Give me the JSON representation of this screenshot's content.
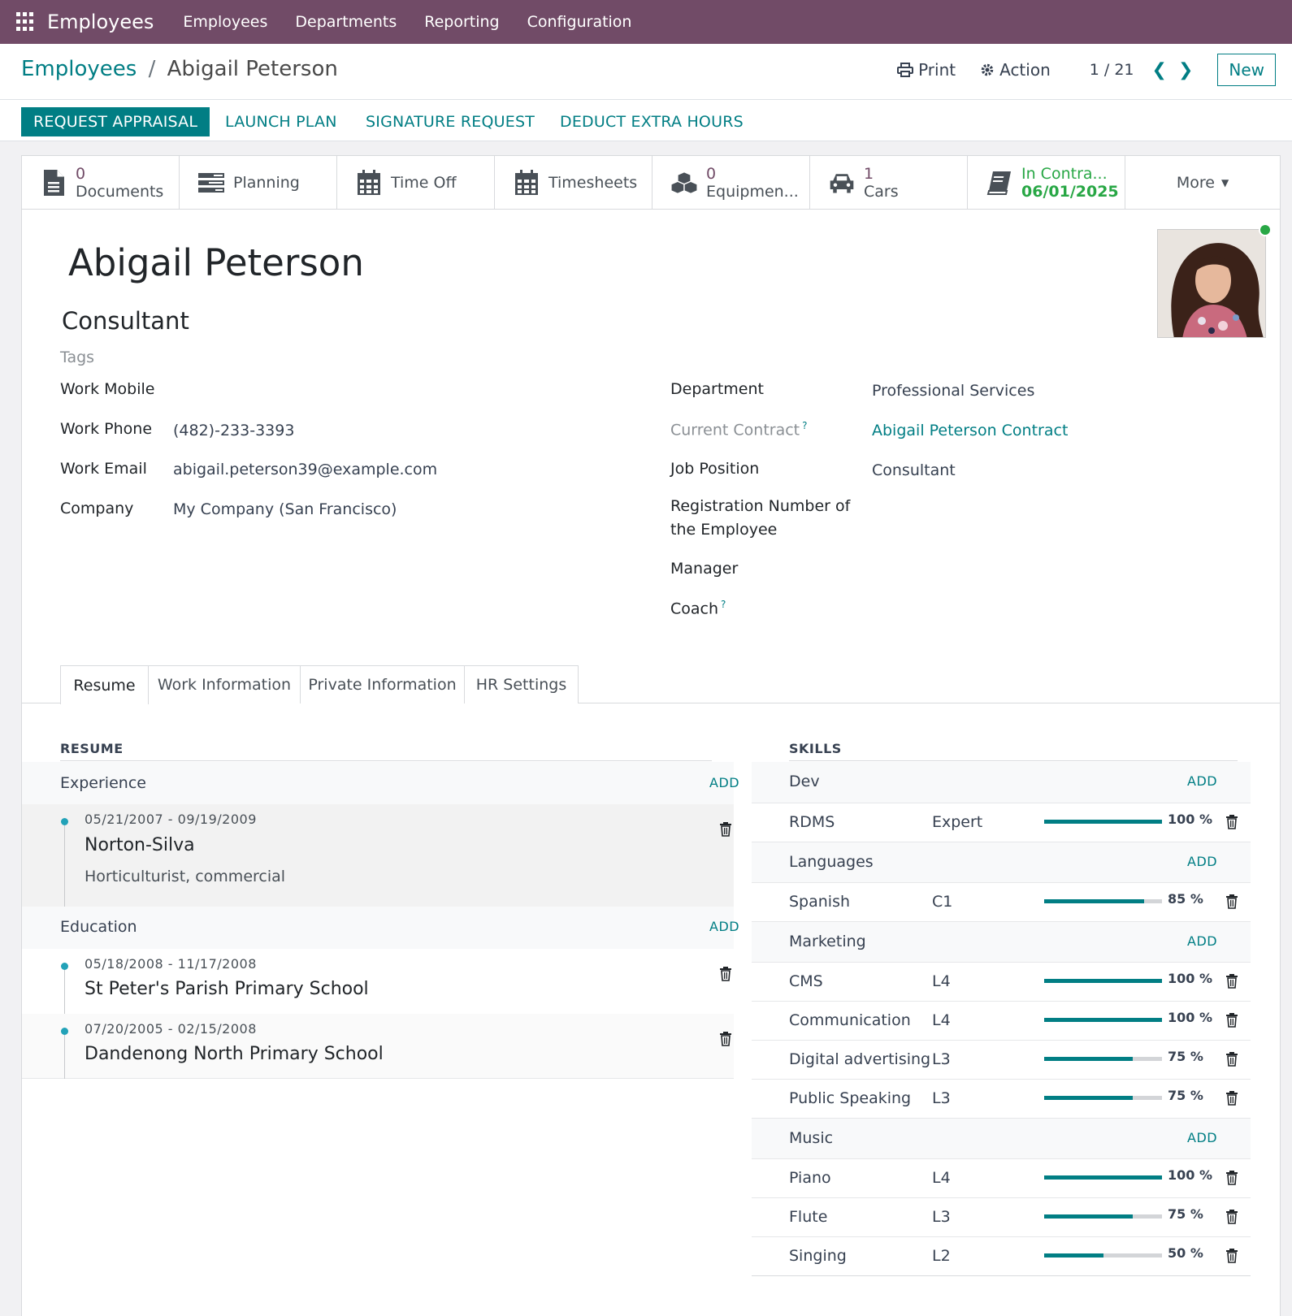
{
  "topnav": {
    "app_title": "Employees",
    "menu": [
      "Employees",
      "Departments",
      "Reporting",
      "Configuration"
    ]
  },
  "breadcrumb": {
    "parent": "Employees",
    "separator": "/",
    "current": "Abigail Peterson"
  },
  "control": {
    "print": "Print",
    "action": "Action",
    "pager": "1 / 21",
    "new": "New"
  },
  "statusbar": {
    "buttons": [
      "REQUEST APPRAISAL",
      "LAUNCH PLAN",
      "SIGNATURE REQUEST",
      "DEDUCT EXTRA HOURS"
    ]
  },
  "smart_buttons": {
    "documents": {
      "value": "0",
      "label": "Documents",
      "icon": "document-icon"
    },
    "planning": {
      "label": "Planning",
      "icon": "planning-icon"
    },
    "timeoff": {
      "label": "Time Off",
      "icon": "calendar-icon"
    },
    "timesheets": {
      "label": "Timesheets",
      "icon": "calendar-icon"
    },
    "equipment": {
      "value": "0",
      "label": "Equipmen...",
      "icon": "cubes-icon"
    },
    "cars": {
      "value": "1",
      "label": "Cars",
      "icon": "car-icon"
    },
    "contract": {
      "value": "In Contra...",
      "label": "06/01/2025",
      "icon": "book-icon"
    },
    "more": {
      "label": "More"
    }
  },
  "employee": {
    "name": "Abigail Peterson",
    "job_title": "Consultant",
    "tags_placeholder": "Tags"
  },
  "fields_left": {
    "work_mobile_label": "Work Mobile",
    "work_mobile": "",
    "work_phone_label": "Work Phone",
    "work_phone": "(482)-233-3393",
    "work_email_label": "Work Email",
    "work_email": "abigail.peterson39@example.com",
    "company_label": "Company",
    "company": "My Company (San Francisco)"
  },
  "fields_right": {
    "department_label": "Department",
    "department": "Professional Services",
    "contract_label": "Current Contract",
    "contract": "Abigail Peterson Contract",
    "job_position_label": "Job Position",
    "job_position": "Consultant",
    "registration_label_1": "Registration Number of",
    "registration_label_2": "the Employee",
    "manager_label": "Manager",
    "coach_label": "Coach",
    "help": "?"
  },
  "tabs": [
    "Resume",
    "Work Information",
    "Private Information",
    "HR Settings"
  ],
  "resume": {
    "title": "RESUME",
    "add": "ADD",
    "groups": [
      {
        "name": "Experience",
        "items": [
          {
            "date": "05/21/2007 - 09/19/2009",
            "name": "Norton-Silva",
            "desc": "Horticulturist, commercial"
          }
        ]
      },
      {
        "name": "Education",
        "items": [
          {
            "date": "05/18/2008 - 11/17/2008",
            "name": "St Peter's Parish Primary School",
            "desc": ""
          },
          {
            "date": "07/20/2005 - 02/15/2008",
            "name": "Dandenong North Primary School",
            "desc": ""
          }
        ]
      }
    ]
  },
  "skills": {
    "title": "SKILLS",
    "add": "ADD",
    "groups": [
      {
        "name": "Dev",
        "items": [
          {
            "name": "RDMS",
            "level": "Expert",
            "progress": 100,
            "pct": "100 %"
          }
        ]
      },
      {
        "name": "Languages",
        "items": [
          {
            "name": "Spanish",
            "level": "C1",
            "progress": 85,
            "pct": "85 %"
          }
        ]
      },
      {
        "name": "Marketing",
        "items": [
          {
            "name": "CMS",
            "level": "L4",
            "progress": 100,
            "pct": "100 %"
          },
          {
            "name": "Communication",
            "level": "L4",
            "progress": 100,
            "pct": "100 %"
          },
          {
            "name": "Digital advertising",
            "level": "L3",
            "progress": 75,
            "pct": "75 %"
          },
          {
            "name": "Public Speaking",
            "level": "L3",
            "progress": 75,
            "pct": "75 %"
          }
        ]
      },
      {
        "name": "Music",
        "items": [
          {
            "name": "Piano",
            "level": "L4",
            "progress": 100,
            "pct": "100 %"
          },
          {
            "name": "Flute",
            "level": "L3",
            "progress": 75,
            "pct": "75 %"
          },
          {
            "name": "Singing",
            "level": "L2",
            "progress": 50,
            "pct": "50 %"
          }
        ]
      }
    ]
  },
  "colors": {
    "brand": "#714b67",
    "accent": "#017e84",
    "status_online": "#28a745"
  }
}
